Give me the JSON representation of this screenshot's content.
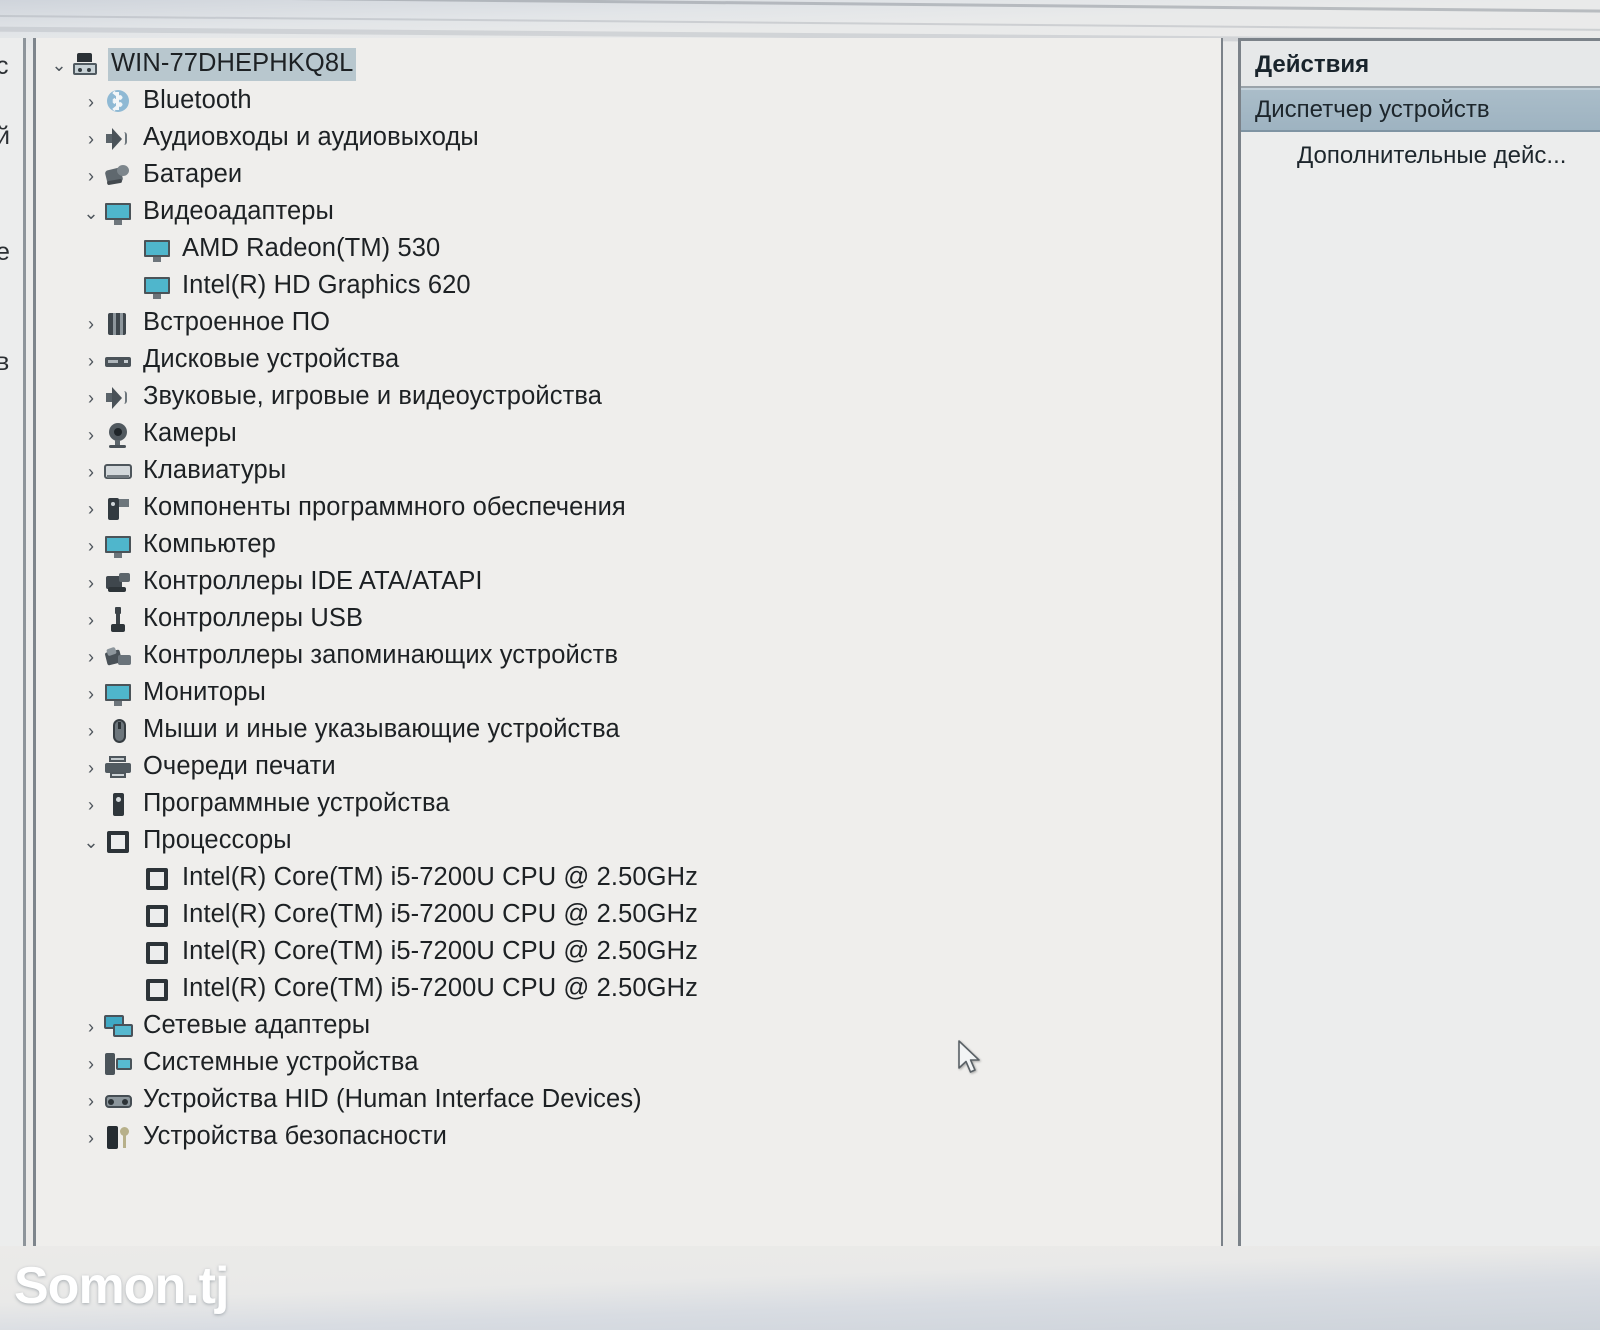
{
  "window": {
    "title": "Диспетчер устройств"
  },
  "left_sliver": {
    "fragments": [
      "с",
      "й",
      "е",
      "в"
    ]
  },
  "tree": {
    "root": {
      "label": "WIN-77DHEPHKQ8L",
      "icon": "computer-icon",
      "expanded": true,
      "selected": true
    },
    "items": [
      {
        "label": "Bluetooth",
        "icon": "bluetooth-icon",
        "level": 1,
        "state": "collapsed"
      },
      {
        "label": "Аудиовходы и аудиовыходы",
        "icon": "speaker-icon",
        "level": 1,
        "state": "collapsed"
      },
      {
        "label": "Батареи",
        "icon": "battery-icon",
        "level": 1,
        "state": "collapsed"
      },
      {
        "label": "Видеоадаптеры",
        "icon": "display-adapter-icon",
        "level": 1,
        "state": "expanded"
      },
      {
        "label": "AMD Radeon(TM) 530",
        "icon": "display-adapter-icon",
        "level": 2,
        "state": "leaf"
      },
      {
        "label": "Intel(R) HD Graphics 620",
        "icon": "display-adapter-icon",
        "level": 2,
        "state": "leaf"
      },
      {
        "label": "Встроенное ПО",
        "icon": "firmware-icon",
        "level": 1,
        "state": "collapsed"
      },
      {
        "label": "Дисковые устройства",
        "icon": "disk-drive-icon",
        "level": 1,
        "state": "collapsed"
      },
      {
        "label": "Звуковые, игровые и видеоустройства",
        "icon": "speaker-icon",
        "level": 1,
        "state": "collapsed"
      },
      {
        "label": "Камеры",
        "icon": "camera-icon",
        "level": 1,
        "state": "collapsed"
      },
      {
        "label": "Клавиатуры",
        "icon": "keyboard-icon",
        "level": 1,
        "state": "collapsed"
      },
      {
        "label": "Компоненты программного обеспечения",
        "icon": "software-component-icon",
        "level": 1,
        "state": "collapsed"
      },
      {
        "label": "Компьютер",
        "icon": "monitor-icon",
        "level": 1,
        "state": "collapsed"
      },
      {
        "label": "Контроллеры IDE ATA/ATAPI",
        "icon": "ide-controller-icon",
        "level": 1,
        "state": "collapsed"
      },
      {
        "label": "Контроллеры USB",
        "icon": "usb-icon",
        "level": 1,
        "state": "collapsed"
      },
      {
        "label": "Контроллеры запоминающих устройств",
        "icon": "storage-controller-icon",
        "level": 1,
        "state": "collapsed"
      },
      {
        "label": "Мониторы",
        "icon": "monitor-icon",
        "level": 1,
        "state": "collapsed"
      },
      {
        "label": "Мыши и иные указывающие устройства",
        "icon": "mouse-icon",
        "level": 1,
        "state": "collapsed"
      },
      {
        "label": "Очереди печати",
        "icon": "printer-icon",
        "level": 1,
        "state": "collapsed"
      },
      {
        "label": "Программные устройства",
        "icon": "software-device-icon",
        "level": 1,
        "state": "collapsed"
      },
      {
        "label": "Процессоры",
        "icon": "processor-icon",
        "level": 1,
        "state": "expanded"
      },
      {
        "label": "Intel(R) Core(TM) i5-7200U CPU @ 2.50GHz",
        "icon": "processor-icon",
        "level": 2,
        "state": "leaf"
      },
      {
        "label": "Intel(R) Core(TM) i5-7200U CPU @ 2.50GHz",
        "icon": "processor-icon",
        "level": 2,
        "state": "leaf"
      },
      {
        "label": "Intel(R) Core(TM) i5-7200U CPU @ 2.50GHz",
        "icon": "processor-icon",
        "level": 2,
        "state": "leaf"
      },
      {
        "label": "Intel(R) Core(TM) i5-7200U CPU @ 2.50GHz",
        "icon": "processor-icon",
        "level": 2,
        "state": "leaf"
      },
      {
        "label": "Сетевые адаптеры",
        "icon": "network-adapter-icon",
        "level": 1,
        "state": "collapsed"
      },
      {
        "label": "Системные устройства",
        "icon": "system-device-icon",
        "level": 1,
        "state": "collapsed"
      },
      {
        "label": "Устройства HID (Human Interface Devices)",
        "icon": "hid-icon",
        "level": 1,
        "state": "collapsed"
      },
      {
        "label": "Устройства безопасности",
        "icon": "security-device-icon",
        "level": 1,
        "state": "collapsed"
      }
    ]
  },
  "actions": {
    "header": "Действия",
    "highlighted_item": "Диспетчер устройств",
    "sub_item": "Дополнительные дейс..."
  },
  "watermark": {
    "text": "Somon.tj"
  },
  "colors": {
    "pane_background": "#efeeec",
    "selection_highlight": "#b8c7ce",
    "actions_highlight": "#9eb3c1",
    "icon_accent": "#4fb6cc",
    "text": "#1d2124"
  }
}
